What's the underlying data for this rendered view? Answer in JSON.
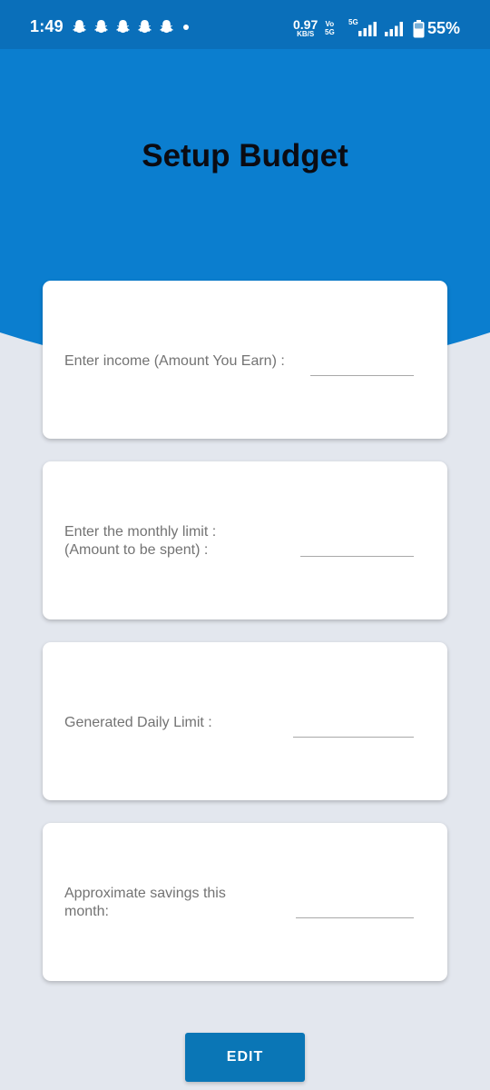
{
  "status_bar": {
    "time": "1:49",
    "net_speed_value": "0.97",
    "net_speed_unit": "KB/S",
    "volte_top": "Vo",
    "volte_bottom": "5G",
    "fiveg_badge": "5G",
    "battery": "55%",
    "notification_icons": [
      "snapchat-icon",
      "snapchat-icon",
      "snapchat-icon",
      "snapchat-icon",
      "snapchat-icon"
    ]
  },
  "header": {
    "title": "Setup Budget",
    "color": "#0b7ecf"
  },
  "cards": [
    {
      "label_line1": "Enter income (Amount You Earn) :",
      "label_line2": "",
      "value": ""
    },
    {
      "label_line1": "Enter the monthly limit :",
      "label_line2": "(Amount to be spent) :",
      "value": ""
    },
    {
      "label_line1": "Generated Daily Limit :",
      "label_line2": "",
      "value": ""
    },
    {
      "label_line1": "Approximate savings this",
      "label_line2": "month:",
      "value": ""
    }
  ],
  "actions": {
    "edit_label": "EDIT"
  }
}
